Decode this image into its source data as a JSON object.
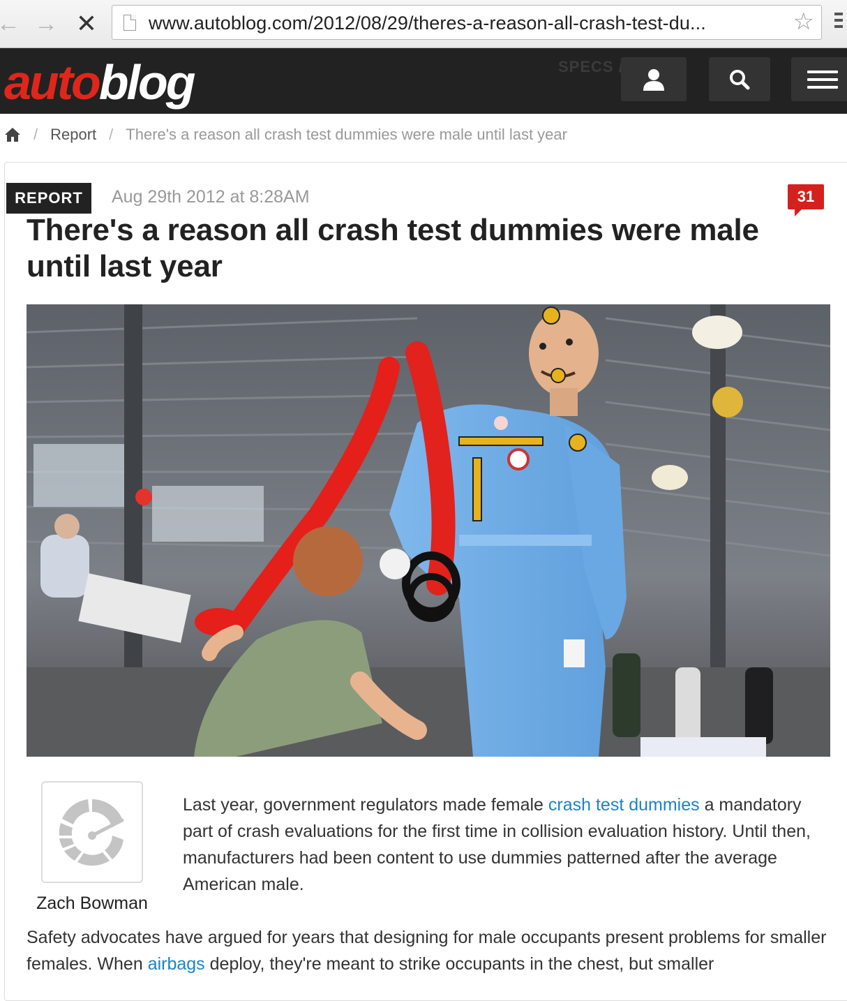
{
  "browser": {
    "url": "www.autoblog.com/2012/08/29/theres-a-reason-all-crash-test-du..."
  },
  "header": {
    "logo_auto": "auto",
    "logo_blog": "blog",
    "specs_ghost": "SPECS /"
  },
  "breadcrumb": {
    "separator": "/",
    "section": "Report",
    "current": "There's a reason all crash test dummies were male until last year"
  },
  "article": {
    "category": "REPORT",
    "date": "Aug 29th 2012 at 8:28AM",
    "comment_count": "31",
    "title": "There's a reason all crash test dummies were male until last year",
    "author": "Zach Bowman",
    "para1": {
      "before": "Last year, government regulators made female ",
      "link": "crash test dummies",
      "after": " a mandatory part of crash evaluations for the first time in collision evaluation history. Until then, manufacturers had been content to use dummies patterned after the average American male."
    },
    "para2": {
      "before": "Safety advocates have argued for years that designing for male occupants present problems for smaller females. When ",
      "link": "airbags",
      "after": " deploy, they're meant to strike occupants in the chest, but smaller"
    }
  },
  "colors": {
    "brand_red": "#e0261b",
    "header_bg": "#222222",
    "link_blue": "#1a84c8",
    "comment_badge": "#d3211e"
  },
  "icons": [
    "back-icon",
    "forward-icon",
    "stop-icon",
    "page-icon",
    "star-icon",
    "user-icon",
    "search-icon",
    "hamburger-icon",
    "home-icon",
    "autoblog-gauge-icon"
  ]
}
